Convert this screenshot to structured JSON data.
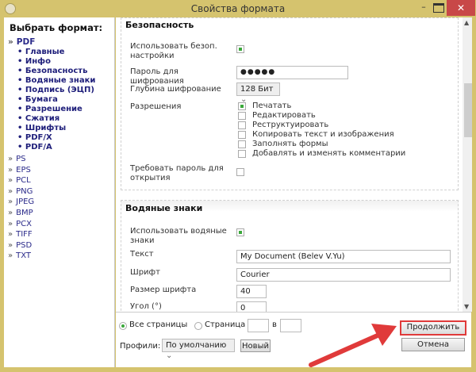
{
  "window": {
    "title": "Свойства формата",
    "minimize": "–",
    "close": "✕"
  },
  "sidebar": {
    "title": "Выбрать формат:",
    "arrow": "»",
    "bullet": "•",
    "pdf": "PDF",
    "pdf_items": [
      "Главные",
      "Инфо",
      "Безопасность",
      "Водяные знаки",
      "Подпись (ЭЦП)",
      "Бумага",
      "Разрешение",
      "Сжатия",
      "Шрифты",
      "PDF/X",
      "PDF/A"
    ],
    "formats": [
      "PS",
      "EPS",
      "PCL",
      "PNG",
      "JPEG",
      "BMP",
      "PCX",
      "TIFF",
      "PSD",
      "TXT"
    ]
  },
  "security": {
    "heading": "Безопасность",
    "use_label": "Использовать безоп. настройки",
    "use_checked": true,
    "password_label": "Пароль для шифрования",
    "password_value": "●●●●●",
    "depth_label": "Глубина шифрование",
    "depth_value": "128 Бит",
    "permissions_label": "Разрешения",
    "permissions": [
      {
        "label": "Печатать",
        "checked": true
      },
      {
        "label": "Редактировать",
        "checked": false
      },
      {
        "label": "Реструктуировать",
        "checked": false
      },
      {
        "label": "Копировать текст и изображения",
        "checked": false
      },
      {
        "label": "Заполнять формы",
        "checked": false
      },
      {
        "label": "Добавлять и изменять комментарии",
        "checked": false
      }
    ],
    "require_label": "Требовать пароль для открытия",
    "require_checked": false
  },
  "watermark": {
    "heading": "Водяные знаки",
    "use_label": "Использовать водяные знаки",
    "use_checked": true,
    "text_label": "Текст",
    "text_value": "My Document (Belev V.Yu)",
    "font_label": "Шрифт",
    "font_value": "Courier",
    "size_label": "Размер шрифта",
    "size_value": "40",
    "angle_label": "Угол (°)",
    "angle_value": "0"
  },
  "bottom": {
    "all_pages": "Все страницы",
    "page": "Страница",
    "in": "в",
    "page_from": "",
    "page_to": "",
    "profiles_label": "Профили:",
    "profile_value": "По умолчанию",
    "new_button": "Новый",
    "continue_button": "Продолжить",
    "cancel_button": "Отмена"
  },
  "colors": {
    "frame": "#d5c36e",
    "highlight": "#e03a3a",
    "check": "#3aa83a"
  }
}
